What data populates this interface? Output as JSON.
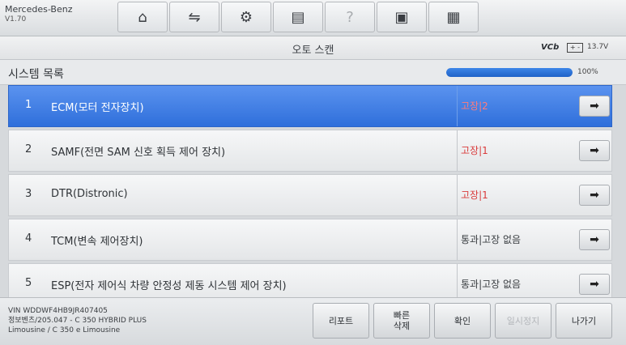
{
  "app": {
    "brand": "Mercedes-Benz",
    "version": "V1.70"
  },
  "toolbar": {
    "items": [
      {
        "name": "home-icon",
        "glyph": "⌂"
      },
      {
        "name": "vehicle-lift-icon",
        "glyph": "⇋"
      },
      {
        "name": "settings-gear-icon",
        "glyph": "⚙"
      },
      {
        "name": "printer-icon",
        "glyph": "▤"
      },
      {
        "name": "help-icon",
        "glyph": "?"
      },
      {
        "name": "save-icon",
        "glyph": "▣"
      },
      {
        "name": "message-icon",
        "glyph": "▦"
      }
    ]
  },
  "titlebar": {
    "title": "오토 스캔",
    "vci": "VCb",
    "battery_icon": "battery-icon",
    "battery_glyph": "+ -",
    "voltage": "13.7V"
  },
  "list": {
    "header": "시스템 목록",
    "progress": 100,
    "progress_label": "100%"
  },
  "rows": [
    {
      "num": "1",
      "name": "ECM(모터 전자장치)",
      "status": "고장|2",
      "fault": true,
      "selected": true
    },
    {
      "num": "2",
      "name": "SAMF(전면 SAM 신호 획득 제어 장치)",
      "status": "고장|1",
      "fault": true,
      "selected": false
    },
    {
      "num": "3",
      "name": "DTR(Distronic)",
      "status": "고장|1",
      "fault": true,
      "selected": false
    },
    {
      "num": "4",
      "name": "TCM(변속 제어장치)",
      "status": "통과|고장 없음",
      "fault": false,
      "selected": false
    },
    {
      "num": "5",
      "name": "ESP(전자 제어식 차량 안정성 제동 시스템 제어 장치)",
      "status": "통과|고장 없음",
      "fault": false,
      "selected": false
    }
  ],
  "vehicle": {
    "line1": "VIN WDDWF4HB9JR407405",
    "line2": "정보벤츠/205.047 - C 350 HYBRID PLUS",
    "line3": "Limousine / C 350 e Limousine"
  },
  "buttons": {
    "report": "리포트",
    "quick_delete": "빠른\n삭제",
    "confirm": "확인",
    "pause": "일시정지",
    "exit": "나가기"
  }
}
